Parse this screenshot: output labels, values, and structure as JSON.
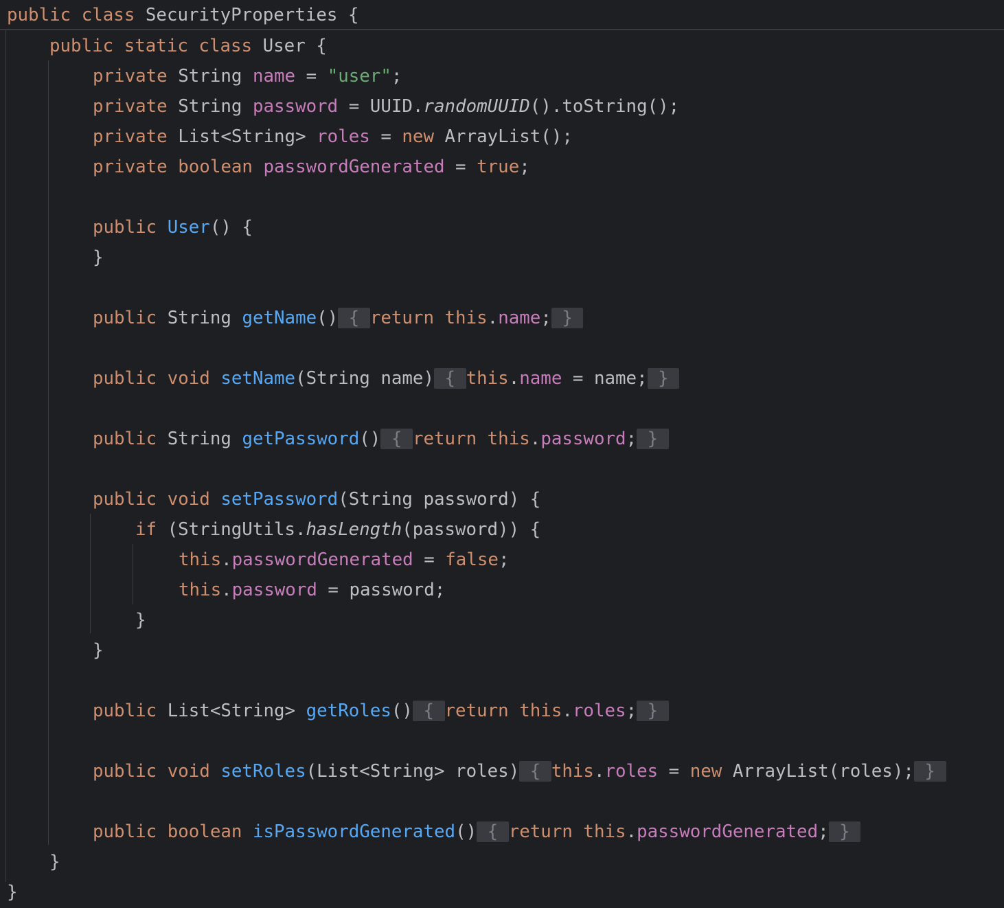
{
  "editor": {
    "language": "Java",
    "theme_colors": {
      "background": "#1e1f22",
      "keyword": "#cf8e6d",
      "string": "#6aab73",
      "field": "#c77dbb",
      "method": "#56a8f5",
      "text": "#bcbec4",
      "fold_marker_bg": "#393b40"
    },
    "fold_open": " { ",
    "fold_close": " } ",
    "lines": [
      [
        {
          "t": "kw",
          "v": "public class "
        },
        {
          "t": "txt",
          "v": "SecurityProperties {"
        }
      ],
      [
        {
          "t": "kw",
          "v": "public static class "
        },
        {
          "t": "txt",
          "v": "User {"
        }
      ],
      [
        {
          "t": "kw",
          "v": "private "
        },
        {
          "t": "txt",
          "v": "String "
        },
        {
          "t": "fld",
          "v": "name"
        },
        {
          "t": "txt",
          "v": " = "
        },
        {
          "t": "str",
          "v": "\"user\""
        },
        {
          "t": "txt",
          "v": ";"
        }
      ],
      [
        {
          "t": "kw",
          "v": "private "
        },
        {
          "t": "txt",
          "v": "String "
        },
        {
          "t": "fld",
          "v": "password"
        },
        {
          "t": "txt",
          "v": " = UUID."
        },
        {
          "t": "it",
          "v": "randomUUID"
        },
        {
          "t": "txt",
          "v": "().toString();"
        }
      ],
      [
        {
          "t": "kw",
          "v": "private "
        },
        {
          "t": "txt",
          "v": "List<String> "
        },
        {
          "t": "fld",
          "v": "roles"
        },
        {
          "t": "txt",
          "v": " = "
        },
        {
          "t": "kw",
          "v": "new "
        },
        {
          "t": "txt",
          "v": "ArrayList();"
        }
      ],
      [
        {
          "t": "kw",
          "v": "private boolean "
        },
        {
          "t": "fld",
          "v": "passwordGenerated"
        },
        {
          "t": "txt",
          "v": " = "
        },
        {
          "t": "kw",
          "v": "true"
        },
        {
          "t": "txt",
          "v": ";"
        }
      ],
      [
        {
          "t": "kw",
          "v": "public "
        },
        {
          "t": "fn",
          "v": "User"
        },
        {
          "t": "txt",
          "v": "() {"
        }
      ],
      [
        {
          "t": "txt",
          "v": "}"
        }
      ],
      [
        {
          "t": "kw",
          "v": "public "
        },
        {
          "t": "txt",
          "v": "String "
        },
        {
          "t": "fn",
          "v": "getName"
        },
        {
          "t": "txt",
          "v": "()"
        },
        {
          "t": "fold",
          "v": " { "
        },
        {
          "t": "kw",
          "v": "return this"
        },
        {
          "t": "txt",
          "v": "."
        },
        {
          "t": "fld",
          "v": "name"
        },
        {
          "t": "txt",
          "v": ";"
        },
        {
          "t": "fold",
          "v": " } "
        }
      ],
      [
        {
          "t": "kw",
          "v": "public void "
        },
        {
          "t": "fn",
          "v": "setName"
        },
        {
          "t": "txt",
          "v": "(String name)"
        },
        {
          "t": "fold",
          "v": " { "
        },
        {
          "t": "kw",
          "v": "this"
        },
        {
          "t": "txt",
          "v": "."
        },
        {
          "t": "fld",
          "v": "name"
        },
        {
          "t": "txt",
          "v": " = name;"
        },
        {
          "t": "fold",
          "v": " } "
        }
      ],
      [
        {
          "t": "kw",
          "v": "public "
        },
        {
          "t": "txt",
          "v": "String "
        },
        {
          "t": "fn",
          "v": "getPassword"
        },
        {
          "t": "txt",
          "v": "()"
        },
        {
          "t": "fold",
          "v": " { "
        },
        {
          "t": "kw",
          "v": "return this"
        },
        {
          "t": "txt",
          "v": "."
        },
        {
          "t": "fld",
          "v": "password"
        },
        {
          "t": "txt",
          "v": ";"
        },
        {
          "t": "fold",
          "v": " } "
        }
      ],
      [
        {
          "t": "kw",
          "v": "public void "
        },
        {
          "t": "fn",
          "v": "setPassword"
        },
        {
          "t": "txt",
          "v": "(String password) {"
        }
      ],
      [
        {
          "t": "kw",
          "v": "if "
        },
        {
          "t": "txt",
          "v": "(StringUtils."
        },
        {
          "t": "it",
          "v": "hasLength"
        },
        {
          "t": "txt",
          "v": "(password)) {"
        }
      ],
      [
        {
          "t": "kw",
          "v": "this"
        },
        {
          "t": "txt",
          "v": "."
        },
        {
          "t": "fld",
          "v": "passwordGenerated"
        },
        {
          "t": "txt",
          "v": " = "
        },
        {
          "t": "kw",
          "v": "false"
        },
        {
          "t": "txt",
          "v": ";"
        }
      ],
      [
        {
          "t": "kw",
          "v": "this"
        },
        {
          "t": "txt",
          "v": "."
        },
        {
          "t": "fld",
          "v": "password"
        },
        {
          "t": "txt",
          "v": " = password;"
        }
      ],
      [
        {
          "t": "txt",
          "v": "}"
        }
      ],
      [
        {
          "t": "txt",
          "v": "}"
        }
      ],
      [
        {
          "t": "kw",
          "v": "public "
        },
        {
          "t": "txt",
          "v": "List<String> "
        },
        {
          "t": "fn",
          "v": "getRoles"
        },
        {
          "t": "txt",
          "v": "()"
        },
        {
          "t": "fold",
          "v": " { "
        },
        {
          "t": "kw",
          "v": "return this"
        },
        {
          "t": "txt",
          "v": "."
        },
        {
          "t": "fld",
          "v": "roles"
        },
        {
          "t": "txt",
          "v": ";"
        },
        {
          "t": "fold",
          "v": " } "
        }
      ],
      [
        {
          "t": "kw",
          "v": "public void "
        },
        {
          "t": "fn",
          "v": "setRoles"
        },
        {
          "t": "txt",
          "v": "(List<String> roles)"
        },
        {
          "t": "fold",
          "v": " { "
        },
        {
          "t": "kw",
          "v": "this"
        },
        {
          "t": "txt",
          "v": "."
        },
        {
          "t": "fld",
          "v": "roles"
        },
        {
          "t": "txt",
          "v": " = "
        },
        {
          "t": "kw",
          "v": "new "
        },
        {
          "t": "txt",
          "v": "ArrayList(roles);"
        },
        {
          "t": "fold",
          "v": " } "
        }
      ],
      [
        {
          "t": "kw",
          "v": "public boolean "
        },
        {
          "t": "fn",
          "v": "isPasswordGenerated"
        },
        {
          "t": "txt",
          "v": "()"
        },
        {
          "t": "fold",
          "v": " { "
        },
        {
          "t": "kw",
          "v": "return this"
        },
        {
          "t": "txt",
          "v": "."
        },
        {
          "t": "fld",
          "v": "passwordGenerated"
        },
        {
          "t": "txt",
          "v": ";"
        },
        {
          "t": "fold",
          "v": " } "
        }
      ],
      [
        {
          "t": "txt",
          "v": "}"
        }
      ],
      [
        {
          "t": "txt",
          "v": "}"
        }
      ]
    ]
  }
}
